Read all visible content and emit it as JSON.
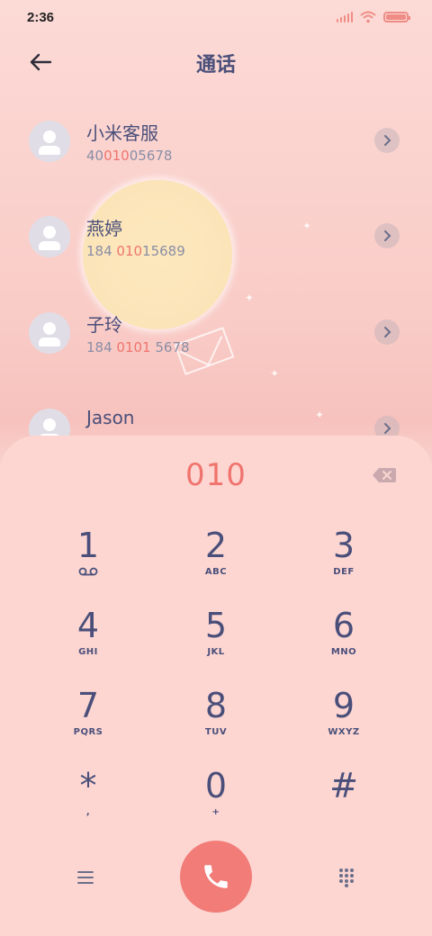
{
  "status": {
    "time": "2:36"
  },
  "header": {
    "title": "通话"
  },
  "contacts": [
    {
      "name": "小米客服",
      "num_pre": "40",
      "num_hl": "010",
      "num_post": "05678"
    },
    {
      "name": "燕婷",
      "num_pre": "184 ",
      "num_hl": "010",
      "num_post": "15689"
    },
    {
      "name": "子玲",
      "num_pre": "184 ",
      "num_hl": "0101",
      "num_post": " 5678"
    },
    {
      "name": "Jason",
      "num_pre": "",
      "num_hl": "",
      "num_post": ""
    }
  ],
  "dialer": {
    "digits": "010",
    "keys": [
      {
        "num": "1",
        "sub": ""
      },
      {
        "num": "2",
        "sub": "ABC"
      },
      {
        "num": "3",
        "sub": "DEF"
      },
      {
        "num": "4",
        "sub": "GHI"
      },
      {
        "num": "5",
        "sub": "JKL"
      },
      {
        "num": "6",
        "sub": "MNO"
      },
      {
        "num": "7",
        "sub": "PQRS"
      },
      {
        "num": "8",
        "sub": "TUV"
      },
      {
        "num": "9",
        "sub": "WXYZ"
      },
      {
        "num": "*",
        "sub": ","
      },
      {
        "num": "0",
        "sub": "+"
      },
      {
        "num": "#",
        "sub": ""
      }
    ]
  },
  "colors": {
    "accent": "#f0746e",
    "call_button": "#f27c78",
    "text": "#4a4f7a",
    "background": "#fdd6d2"
  },
  "icons": [
    "back-arrow-icon",
    "chevron-right-icon",
    "backspace-icon",
    "voicemail-icon",
    "menu-icon",
    "phone-icon",
    "dialpad-icon",
    "wifi-icon",
    "signal-icon",
    "battery-icon"
  ]
}
